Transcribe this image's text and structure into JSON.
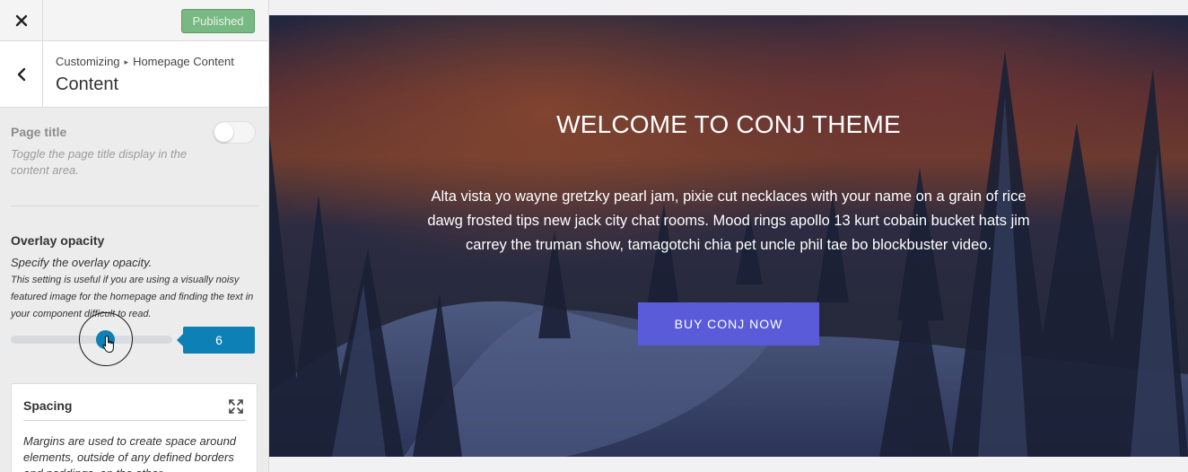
{
  "topbar": {
    "publish_label": "Published",
    "close_icon": "close-icon"
  },
  "section": {
    "breadcrumb_root": "Customizing",
    "breadcrumb_parent": "Homepage Content",
    "title": "Content",
    "back_icon": "chevron-left-icon"
  },
  "page_title_control": {
    "title": "Page title",
    "description": "Toggle the page title display in the content area.",
    "enabled": false
  },
  "overlay_control": {
    "title": "Overlay opacity",
    "description": "Specify the overlay opacity.",
    "note": "This setting is useful if you are using a visually noisy featured image for the homepage and finding the text in your component difficult to read.",
    "value": "6"
  },
  "spacing_control": {
    "title": "Spacing",
    "description": "Margins are used to create space around elements, outside of any defined borders and paddings, on the other",
    "expand_icon": "expand-icon"
  },
  "preview": {
    "hero_title": "WELCOME TO CONJ THEME",
    "hero_text": "Alta vista yo wayne gretzky pearl jam, pixie cut necklaces with your name on a grain of rice dawg frosted tips new jack city chat rooms. Mood rings apollo 13 kurt cobain bucket hats jim carrey the truman show, tamagotchi chia pet uncle phil tae bo blockbuster video.",
    "button_label": "BUY CONJ NOW"
  },
  "colors": {
    "publish_button": "#78b882",
    "accent_blue": "#0d80b6",
    "hero_button": "#5a5bd8"
  }
}
